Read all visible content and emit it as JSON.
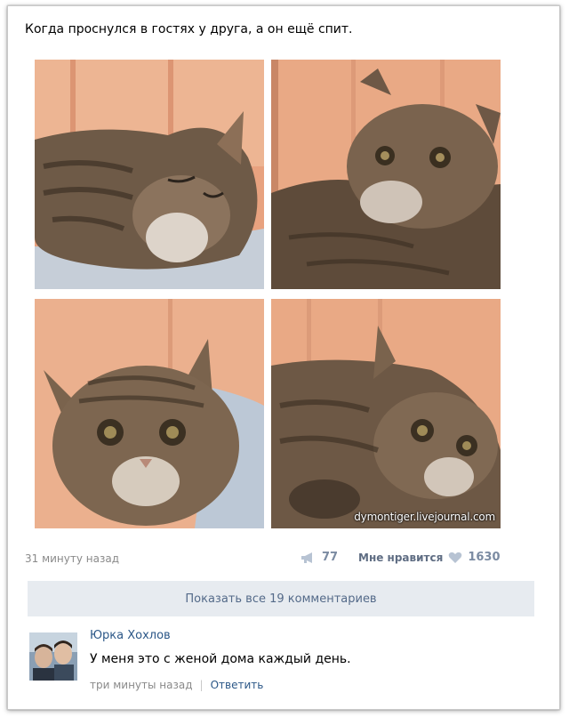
{
  "post": {
    "text": "Когда проснулся в гостях у друга, а он ещё спит.",
    "watermark": "dymontiger.livejournal.com",
    "time": "31 минуту назад",
    "share_count": "77",
    "like_label": "Мне нравится",
    "like_count": "1630",
    "photos": [
      {
        "icon": "cat-photo-1"
      },
      {
        "icon": "cat-photo-2"
      },
      {
        "icon": "cat-photo-3"
      },
      {
        "icon": "cat-photo-4"
      }
    ]
  },
  "comments": {
    "show_all_label": "Показать все 19 комментариев",
    "items": [
      {
        "author": "Юрка Хохлов",
        "text": "У меня это с женой дома каждый день.",
        "time": "три минуты назад",
        "separator": "|",
        "reply_label": "Ответить"
      }
    ]
  },
  "colors": {
    "link": "#2b5787",
    "muted": "#8a8a8a",
    "button_bg": "#e7ebf0",
    "photo_wall": "#e9a985"
  }
}
